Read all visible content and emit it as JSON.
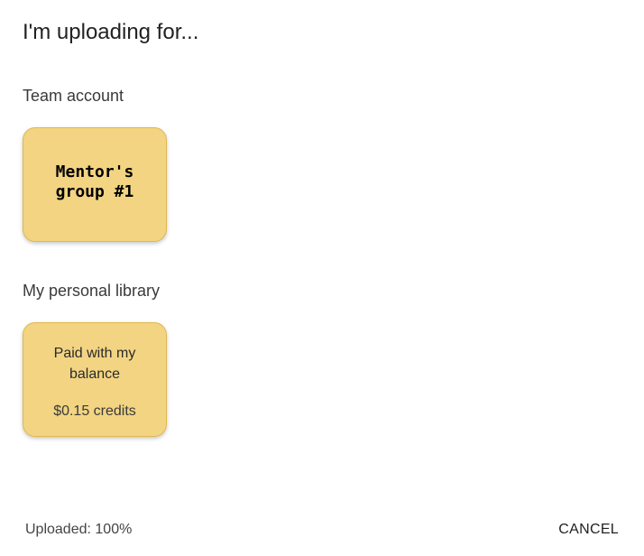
{
  "dialog": {
    "title": "I'm uploading for..."
  },
  "team_section": {
    "label": "Team account",
    "card": {
      "name": "Mentor's group #1"
    }
  },
  "personal_section": {
    "label": "My personal library",
    "card": {
      "name": "Paid with my balance",
      "credits": "$0.15 credits"
    }
  },
  "footer": {
    "status": "Uploaded: 100%",
    "cancel_label": "CANCEL"
  },
  "colors": {
    "card_background": "#f2d482",
    "card_border": "#e0b84f"
  }
}
